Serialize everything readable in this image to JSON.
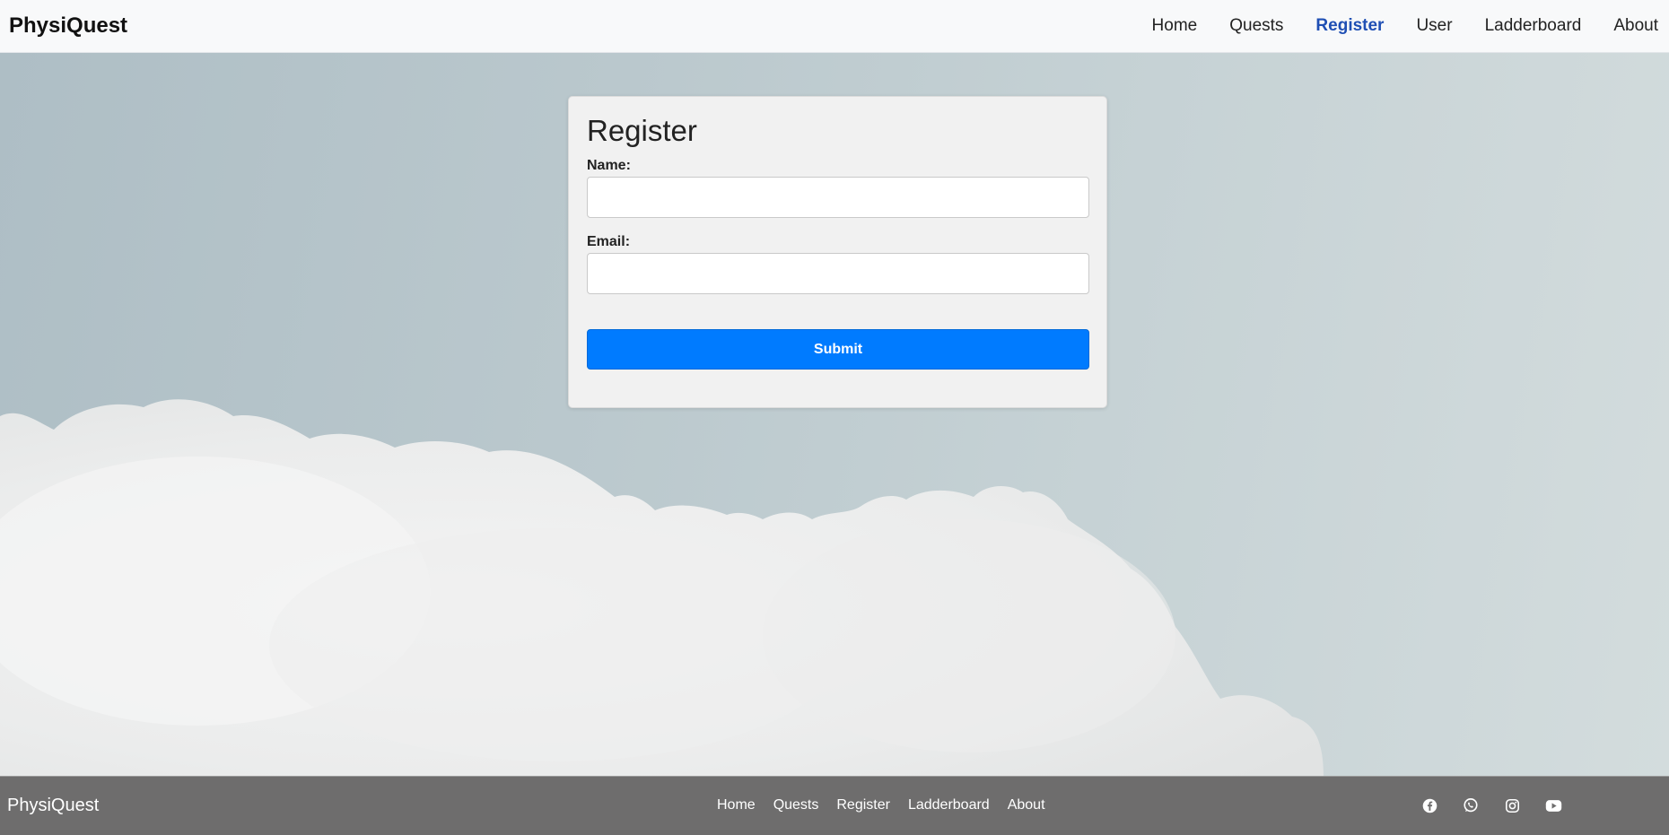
{
  "navbar": {
    "brand": "PhysiQuest",
    "links": [
      {
        "label": "Home",
        "active": false
      },
      {
        "label": "Quests",
        "active": false
      },
      {
        "label": "Register",
        "active": true
      },
      {
        "label": "User",
        "active": false
      },
      {
        "label": "Ladderboard",
        "active": false
      },
      {
        "label": "About",
        "active": false
      }
    ]
  },
  "form": {
    "title": "Register",
    "name_label": "Name:",
    "name_value": "",
    "email_label": "Email:",
    "email_value": "",
    "submit_label": "Submit"
  },
  "footer": {
    "brand": "PhysiQuest",
    "links": [
      "Home",
      "Quests",
      "Register",
      "Ladderboard",
      "About"
    ],
    "social_icons": [
      "facebook-icon",
      "whatsapp-icon",
      "instagram-icon",
      "youtube-icon"
    ]
  },
  "colors": {
    "accent": "#007bff",
    "active_nav": "#1f4fb4",
    "footer_bg": "#6e6d6d",
    "navbar_bg": "#f8f9fa"
  }
}
